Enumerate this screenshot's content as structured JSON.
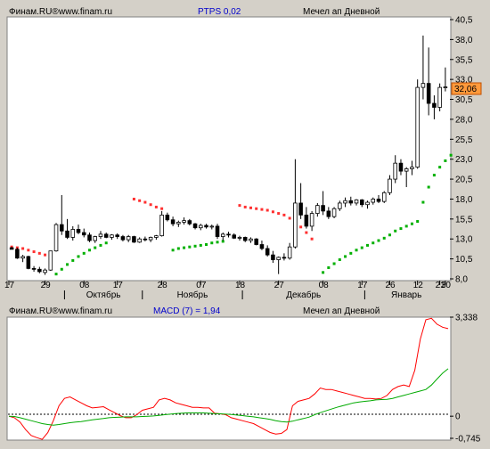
{
  "colors": {
    "background": "#d4d0c8",
    "panel": "#ffffff",
    "candle_up": "#ffffff",
    "candle_down": "#000000",
    "sar_above": "#ff3030",
    "sar_below": "#00b000",
    "last_price_bg": "#ff9a3c",
    "macd_line": "#ff0000",
    "signal_line": "#00aa00",
    "header_blue": "#0000cc"
  },
  "top_panel": {
    "source": "Финам.RU®",
    "site": "www.finam.ru",
    "indicator": "PTPS 0,02",
    "title": "Мечел ап Дневной",
    "last_price": "32,06"
  },
  "bottom_panel": {
    "source": "Финам.RU®",
    "site": "www.finam.ru",
    "indicator": "MACD (7) = 1,94",
    "title": "Мечел ап Дневной"
  },
  "chart_data": [
    {
      "type": "candlestick",
      "ylim": [
        8.0,
        40.5
      ],
      "y_ticks": [
        "40,5",
        "38,0",
        "35,5",
        "33,0",
        "30,5",
        "28,0",
        "25,5",
        "23,0",
        "20,5",
        "18,0",
        "15,5",
        "13,0",
        "10,5",
        "8,0"
      ],
      "day_ticks": [
        "17",
        "29",
        "08",
        "17",
        "28",
        "07",
        "18",
        "27",
        "08",
        "17",
        "26",
        "12",
        "21",
        "30"
      ],
      "month_labels": [
        "Октябрь",
        "Ноябрь",
        "Декабрь",
        "Январь"
      ],
      "candles": [
        [
          11.9,
          12.0,
          11.7,
          11.7
        ],
        [
          11.7,
          11.9,
          10.5,
          10.6
        ],
        [
          10.6,
          11.0,
          10.1,
          10.8
        ],
        [
          10.8,
          10.9,
          9.2,
          9.3
        ],
        [
          9.3,
          9.6,
          8.9,
          9.2
        ],
        [
          9.2,
          9.5,
          8.7,
          8.9
        ],
        [
          8.8,
          9.3,
          8.5,
          9.1
        ],
        [
          9.1,
          11.5,
          9.0,
          11.5
        ],
        [
          11.5,
          15.0,
          11.4,
          14.8
        ],
        [
          14.8,
          18.5,
          13.5,
          14.0
        ],
        [
          14.0,
          15.5,
          13.0,
          13.2
        ],
        [
          13.2,
          14.6,
          12.8,
          14.2
        ],
        [
          14.2,
          14.8,
          13.6,
          13.8
        ],
        [
          13.8,
          14.3,
          13.2,
          13.5
        ],
        [
          13.5,
          13.8,
          12.6,
          12.8
        ],
        [
          12.8,
          13.4,
          12.5,
          13.3
        ],
        [
          13.3,
          14.0,
          13.0,
          13.6
        ],
        [
          13.6,
          13.8,
          13.1,
          13.2
        ],
        [
          13.2,
          13.6,
          12.9,
          13.5
        ],
        [
          13.5,
          13.7,
          13.0,
          13.3
        ],
        [
          13.3,
          13.5,
          12.7,
          12.9
        ],
        [
          12.9,
          13.5,
          12.6,
          13.3
        ],
        [
          13.3,
          13.4,
          12.5,
          12.6
        ],
        [
          12.6,
          13.2,
          12.5,
          13.0
        ],
        [
          13.0,
          13.3,
          12.7,
          12.9
        ],
        [
          12.9,
          13.3,
          12.6,
          13.2
        ],
        [
          13.2,
          13.5,
          12.9,
          13.4
        ],
        [
          13.4,
          16.5,
          13.3,
          16.0
        ],
        [
          16.0,
          16.3,
          15.2,
          15.4
        ],
        [
          15.4,
          15.8,
          14.6,
          14.9
        ],
        [
          14.9,
          15.3,
          14.5,
          15.1
        ],
        [
          15.1,
          15.7,
          14.8,
          15.3
        ],
        [
          15.3,
          15.5,
          14.7,
          14.9
        ],
        [
          14.9,
          15.0,
          14.2,
          14.4
        ],
        [
          14.4,
          14.9,
          14.1,
          14.7
        ],
        [
          14.7,
          14.9,
          14.3,
          14.5
        ],
        [
          14.5,
          14.8,
          14.2,
          14.6
        ],
        [
          14.6,
          14.9,
          13.0,
          13.3
        ],
        [
          13.3,
          13.8,
          12.8,
          13.6
        ],
        [
          13.6,
          13.9,
          13.2,
          13.5
        ],
        [
          13.5,
          13.7,
          13.0,
          13.1
        ],
        [
          13.1,
          13.4,
          12.8,
          13.2
        ],
        [
          13.2,
          13.3,
          12.6,
          12.8
        ],
        [
          12.8,
          13.2,
          12.5,
          13.0
        ],
        [
          13.0,
          13.1,
          12.2,
          12.3
        ],
        [
          12.3,
          12.8,
          11.6,
          11.8
        ],
        [
          11.8,
          12.2,
          10.8,
          11.0
        ],
        [
          11.0,
          11.5,
          10.0,
          10.4
        ],
        [
          10.4,
          10.8,
          8.6,
          10.7
        ],
        [
          10.7,
          11.2,
          10.3,
          10.6
        ],
        [
          10.6,
          12.5,
          10.4,
          12.0
        ],
        [
          12.0,
          23.0,
          11.8,
          17.5
        ],
        [
          17.5,
          20.0,
          15.5,
          16.0
        ],
        [
          16.0,
          17.0,
          14.3,
          14.6
        ],
        [
          14.6,
          16.5,
          14.0,
          16.2
        ],
        [
          16.2,
          17.5,
          15.8,
          17.2
        ],
        [
          17.2,
          19.0,
          16.0,
          16.5
        ],
        [
          16.5,
          17.0,
          15.5,
          15.8
        ],
        [
          15.8,
          17.0,
          15.6,
          16.8
        ],
        [
          16.8,
          17.8,
          16.5,
          17.5
        ],
        [
          17.5,
          18.2,
          17.0,
          17.8
        ],
        [
          17.8,
          18.3,
          17.2,
          17.5
        ],
        [
          17.5,
          18.0,
          17.2,
          17.9
        ],
        [
          17.9,
          18.0,
          17.0,
          17.3
        ],
        [
          17.3,
          17.8,
          16.8,
          17.6
        ],
        [
          17.6,
          18.2,
          17.3,
          18.0
        ],
        [
          18.0,
          18.5,
          17.5,
          17.7
        ],
        [
          17.7,
          19.0,
          17.5,
          18.8
        ],
        [
          18.8,
          21.0,
          18.5,
          20.5
        ],
        [
          20.5,
          23.5,
          20.0,
          22.5
        ],
        [
          22.5,
          23.0,
          21.0,
          21.5
        ],
        [
          21.5,
          22.0,
          19.5,
          21.8
        ],
        [
          21.8,
          22.8,
          21.0,
          22.0
        ],
        [
          22.0,
          33.0,
          21.8,
          32.0
        ],
        [
          32.0,
          38.5,
          30.5,
          32.5
        ],
        [
          32.5,
          37.0,
          28.5,
          30.0
        ],
        [
          30.0,
          31.0,
          28.0,
          29.5
        ],
        [
          29.5,
          32.5,
          29.0,
          32.0
        ],
        [
          32.0,
          34.5,
          31.5,
          32.06
        ]
      ],
      "sar_above": [
        [
          12.0,
          0
        ],
        [
          11.9,
          1
        ],
        [
          11.8,
          2
        ],
        [
          11.6,
          3
        ],
        [
          11.4,
          4
        ],
        [
          11.2,
          5
        ],
        [
          11.0,
          6
        ],
        [
          18.0,
          22
        ],
        [
          17.8,
          23
        ],
        [
          17.6,
          24
        ],
        [
          17.3,
          25
        ],
        [
          17.0,
          26
        ],
        [
          16.8,
          27
        ],
        [
          17.2,
          41
        ],
        [
          17.0,
          42
        ],
        [
          16.9,
          43
        ],
        [
          16.8,
          44
        ],
        [
          16.7,
          45
        ],
        [
          16.6,
          46
        ],
        [
          16.4,
          47
        ],
        [
          16.2,
          48
        ],
        [
          16.0,
          49
        ],
        [
          15.6,
          50
        ],
        [
          15.1,
          51
        ],
        [
          14.5,
          52
        ],
        [
          13.8,
          53
        ],
        [
          13.0,
          54
        ]
      ],
      "sar_below": [
        [
          8.6,
          8
        ],
        [
          9.2,
          9
        ],
        [
          9.8,
          10
        ],
        [
          10.3,
          11
        ],
        [
          10.8,
          12
        ],
        [
          11.2,
          13
        ],
        [
          11.6,
          14
        ],
        [
          11.9,
          15
        ],
        [
          12.2,
          16
        ],
        [
          12.5,
          17
        ],
        [
          11.6,
          29
        ],
        [
          11.8,
          30
        ],
        [
          11.9,
          31
        ],
        [
          12.0,
          32
        ],
        [
          12.1,
          33
        ],
        [
          12.2,
          34
        ],
        [
          12.3,
          35
        ],
        [
          12.5,
          36
        ],
        [
          12.6,
          37
        ],
        [
          12.7,
          38
        ],
        [
          8.8,
          56
        ],
        [
          9.4,
          57
        ],
        [
          9.9,
          58
        ],
        [
          10.4,
          59
        ],
        [
          10.8,
          60
        ],
        [
          11.2,
          61
        ],
        [
          11.6,
          62
        ],
        [
          11.9,
          63
        ],
        [
          12.2,
          64
        ],
        [
          12.5,
          65
        ],
        [
          12.8,
          66
        ],
        [
          13.1,
          67
        ],
        [
          13.5,
          68
        ],
        [
          14.0,
          69
        ],
        [
          14.3,
          70
        ],
        [
          14.6,
          71
        ],
        [
          14.9,
          72
        ],
        [
          15.2,
          73
        ],
        [
          17.6,
          74
        ],
        [
          19.5,
          75
        ],
        [
          21.0,
          76
        ],
        [
          22.0,
          77
        ],
        [
          22.8,
          78
        ],
        [
          23.5,
          79
        ]
      ]
    },
    {
      "type": "line",
      "ylim": [
        -0.745,
        3.338
      ],
      "y_ticks": [
        "3,338",
        "0",
        "-0,745"
      ],
      "series": [
        {
          "name": "MACD",
          "values": [
            0.0,
            -0.05,
            -0.2,
            -0.45,
            -0.65,
            -0.72,
            -0.78,
            -0.55,
            -0.15,
            0.35,
            0.6,
            0.65,
            0.55,
            0.45,
            0.35,
            0.28,
            0.3,
            0.32,
            0.22,
            0.12,
            0.02,
            -0.05,
            -0.05,
            0.05,
            0.2,
            0.25,
            0.3,
            0.55,
            0.6,
            0.55,
            0.45,
            0.4,
            0.35,
            0.3,
            0.3,
            0.28,
            0.28,
            0.1,
            0.08,
            0.05,
            -0.05,
            -0.1,
            -0.15,
            -0.2,
            -0.25,
            -0.35,
            -0.45,
            -0.55,
            -0.6,
            -0.58,
            -0.45,
            0.35,
            0.5,
            0.55,
            0.6,
            0.75,
            0.95,
            0.9,
            0.9,
            0.85,
            0.8,
            0.75,
            0.7,
            0.65,
            0.6,
            0.6,
            0.58,
            0.6,
            0.7,
            0.9,
            1.0,
            1.05,
            1.0,
            1.55,
            2.6,
            3.25,
            3.3,
            3.1,
            3.0,
            2.95
          ]
        },
        {
          "name": "Signal",
          "values": [
            0.0,
            -0.01,
            -0.05,
            -0.1,
            -0.15,
            -0.2,
            -0.25,
            -0.28,
            -0.3,
            -0.28,
            -0.25,
            -0.22,
            -0.2,
            -0.18,
            -0.15,
            -0.12,
            -0.1,
            -0.08,
            -0.05,
            -0.04,
            -0.03,
            -0.02,
            -0.02,
            -0.02,
            -0.01,
            0.0,
            0.01,
            0.03,
            0.05,
            0.07,
            0.09,
            0.1,
            0.11,
            0.11,
            0.11,
            0.11,
            0.1,
            0.09,
            0.08,
            0.07,
            0.06,
            0.04,
            0.02,
            0.0,
            -0.02,
            -0.05,
            -0.08,
            -0.11,
            -0.15,
            -0.18,
            -0.2,
            -0.17,
            -0.12,
            -0.08,
            -0.03,
            0.05,
            0.12,
            0.18,
            0.24,
            0.3,
            0.35,
            0.4,
            0.45,
            0.48,
            0.5,
            0.52,
            0.55,
            0.56,
            0.57,
            0.6,
            0.65,
            0.7,
            0.75,
            0.8,
            0.85,
            0.9,
            1.05,
            1.25,
            1.45,
            1.6
          ]
        }
      ]
    }
  ]
}
